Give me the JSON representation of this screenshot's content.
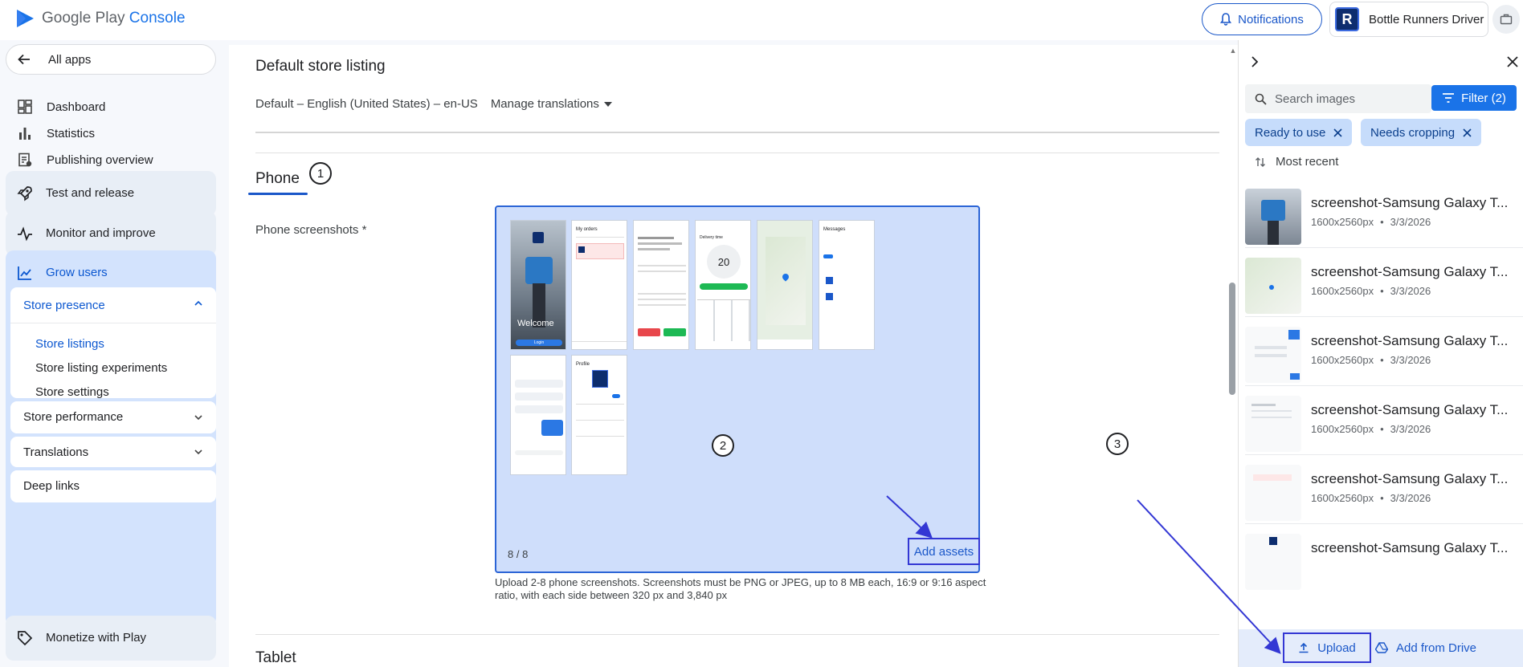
{
  "brand": {
    "name_prefix": "Google Play",
    "name_suffix": "Console"
  },
  "header": {
    "notifications_label": "Notifications",
    "account_name": "Bottle Runners Driver",
    "account_avatar_letter": "R"
  },
  "sidebar": {
    "all_apps": "All apps",
    "items": [
      {
        "label": "Dashboard",
        "icon": "dashboard-icon"
      },
      {
        "label": "Statistics",
        "icon": "bar-chart-icon"
      },
      {
        "label": "Publishing overview",
        "icon": "publishing-icon"
      }
    ],
    "groups": {
      "test_release": "Test and release",
      "monitor": "Monitor and improve",
      "grow": "Grow users",
      "monetize": "Monetize with Play"
    },
    "store_presence": {
      "label": "Store presence",
      "links": [
        "Store listings",
        "Store listing experiments",
        "Store settings"
      ]
    },
    "store_performance": "Store performance",
    "translations": "Translations",
    "deep_links": "Deep links"
  },
  "main": {
    "title": "Default store listing",
    "language": "Default – English (United States) – en-US",
    "manage_translations": "Manage translations",
    "phone_tab": "Phone",
    "phone_screenshots_label": "Phone screenshots",
    "required_mark": "*",
    "counter": "8 / 8",
    "add_assets": "Add assets",
    "hint": "Upload 2-8 phone screenshots. Screenshots must be PNG or JPEG, up to 8 MB each, 16:9 or 9:16 aspect ratio, with each side between 320 px and 3,840 px",
    "tablet_tab": "Tablet",
    "screenshots": {
      "welcome": "Welcome",
      "login": "Login",
      "my_orders": "My orders",
      "delivery_time": "Delivery time",
      "minutes_value": "20",
      "messages": "Messages",
      "profile": "Profile"
    }
  },
  "callouts": [
    "1",
    "2",
    "3"
  ],
  "panel": {
    "search_placeholder": "Search images",
    "filter_label": "Filter (2)",
    "chips": [
      "Ready to use",
      "Needs cropping"
    ],
    "sort_label": "Most recent",
    "images": [
      {
        "name": "screenshot-Samsung Galaxy T...",
        "size": "1600x2560px",
        "date": "3/3/2026"
      },
      {
        "name": "screenshot-Samsung Galaxy T...",
        "size": "1600x2560px",
        "date": "3/3/2026"
      },
      {
        "name": "screenshot-Samsung Galaxy T...",
        "size": "1600x2560px",
        "date": "3/3/2026"
      },
      {
        "name": "screenshot-Samsung Galaxy T...",
        "size": "1600x2560px",
        "date": "3/3/2026"
      },
      {
        "name": "screenshot-Samsung Galaxy T...",
        "size": "1600x2560px",
        "date": "3/3/2026"
      },
      {
        "name": "screenshot-Samsung Galaxy T...",
        "size": "",
        "date": ""
      }
    ],
    "meta_separator": "•",
    "upload_label": "Upload",
    "drive_label": "Add from Drive"
  },
  "colors": {
    "accent": "#1a73e8",
    "selection_bg": "#cfdefb",
    "annotation": "#3337d4"
  }
}
